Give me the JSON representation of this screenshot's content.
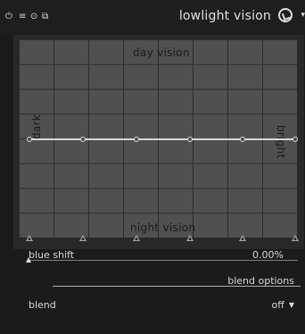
{
  "module": {
    "title": "lowlight vision",
    "header_icons": {
      "power": "⏻",
      "multi_instance": "≡",
      "reset": "⊙",
      "presets_menu": "⧉"
    },
    "preset_icon": "preset-icon",
    "more_icon": "▾"
  },
  "graph": {
    "label_top": "day vision",
    "label_bottom": "night vision",
    "label_left": "dark",
    "label_right": "bright"
  },
  "slider": {
    "label": "blue shift",
    "value": "0.00%",
    "fraction": 0.0
  },
  "blend": {
    "section": "blend options",
    "label": "blend",
    "value": "off",
    "dropdown_arrow": "▼"
  }
}
